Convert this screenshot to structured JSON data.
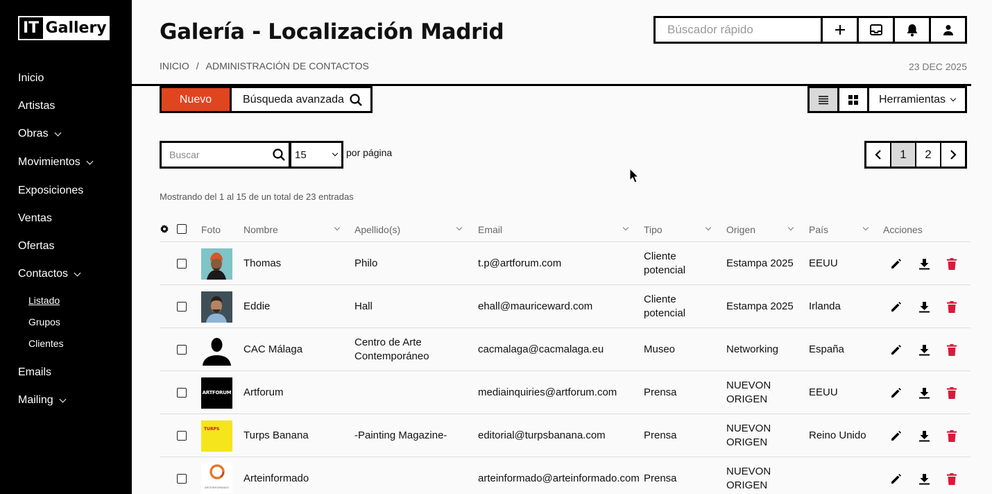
{
  "app": {
    "logo_it": "IT",
    "logo_gallery": "Gallery"
  },
  "sidebar": {
    "items": [
      {
        "label": "Inicio"
      },
      {
        "label": "Artistas"
      },
      {
        "label": "Obras"
      },
      {
        "label": "Movimientos"
      },
      {
        "label": "Exposiciones"
      },
      {
        "label": "Ventas"
      },
      {
        "label": "Ofertas"
      },
      {
        "label": "Contactos"
      },
      {
        "label": "Emails"
      },
      {
        "label": "Mailing"
      }
    ],
    "contactos_sub": [
      {
        "label": "Listado"
      },
      {
        "label": "Grupos"
      },
      {
        "label": "Clientes"
      }
    ]
  },
  "header": {
    "title": "Galería - Localización Madrid",
    "breadcrumb_home": "INICIO",
    "breadcrumb_sep": "/",
    "breadcrumb_current": "ADMINISTRACIÓN DE CONTACTOS",
    "date": "23 DEC 2025",
    "quick_search_placeholder": "Búscador rápido"
  },
  "toolbar": {
    "new_label": "Nuevo",
    "advanced_search_label": "Búsqueda avanzada",
    "tools_label": "Herramientas"
  },
  "filters": {
    "search_placeholder": "Buscar",
    "per_page_value": "15",
    "per_page_label": "por página",
    "pages": [
      "1",
      "2"
    ],
    "current_page": "1",
    "showing": "Mostrando del 1 al 15 de un total de 23 entradas"
  },
  "table": {
    "headers": {
      "photo": "Foto",
      "name": "Nombre",
      "surname": "Apellido(s)",
      "email": "Email",
      "type": "Tipo",
      "origin": "Origen",
      "country": "País",
      "actions": "Acciones"
    },
    "rows": [
      {
        "name": "Thomas",
        "surname": "Philo",
        "email": "t.p@artforum.com",
        "type_1": "Cliente",
        "type_2": "potencial",
        "origin_1": "Estampa 2025",
        "origin_2": "",
        "country": "EEUU",
        "photo": "portrait-orange-beanie"
      },
      {
        "name": "Eddie",
        "surname": "Hall",
        "email": "ehall@mauriceward.com",
        "type_1": "Cliente",
        "type_2": "potencial",
        "origin_1": "Estampa 2025",
        "origin_2": "",
        "country": "Irlanda",
        "photo": "portrait-blue-shirt"
      },
      {
        "name": "CAC Málaga",
        "surname": "Centro de Arte Contemporáneo",
        "email": "cacmalaga@cacmalaga.eu",
        "type_1": "Museo",
        "type_2": "",
        "origin_1": "Networking",
        "origin_2": "",
        "country": "España",
        "photo": "silhouette-placeholder"
      },
      {
        "name": "Artforum",
        "surname": "",
        "email": "mediainquiries@artforum.com",
        "type_1": "Prensa",
        "type_2": "",
        "origin_1": "NUEVON",
        "origin_2": "ORIGEN",
        "country": "EEUU",
        "photo": "artforum-logo",
        "photo_text": "ARTFORUM"
      },
      {
        "name": "Turps Banana",
        "surname": "-Painting Magazine-",
        "email": "editorial@turpsbanana.com",
        "type_1": "Prensa",
        "type_2": "",
        "origin_1": "NUEVON",
        "origin_2": "ORIGEN",
        "country": "Reino Unido",
        "photo": "turps-yellow-cover",
        "photo_text": "TURPS"
      },
      {
        "name": "Arteinformado",
        "surname": "",
        "email": "arteinformado@arteinformado.com",
        "type_1": "Prensa",
        "type_2": "",
        "origin_1": "NUEVON",
        "origin_2": "ORIGEN",
        "country": "",
        "photo": "arteinformado-ring-logo",
        "photo_text": "ARTEINFORMADO"
      }
    ]
  },
  "colors": {
    "sidebar_bg": "#000000",
    "accent": "#e0451f",
    "delete": "#d81b3c",
    "active_view": "#d9d9d9"
  }
}
